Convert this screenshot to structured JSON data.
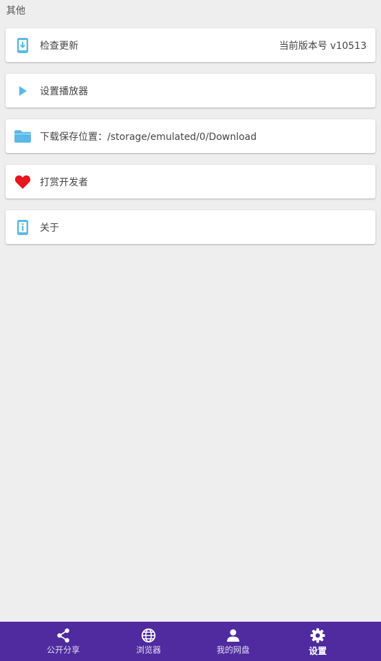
{
  "section": {
    "title": "其他"
  },
  "items": [
    {
      "label": "检查更新",
      "value": "当前版本号 v10513",
      "icon": "phone-download-icon"
    },
    {
      "label": "设置播放器",
      "icon": "play-icon"
    },
    {
      "label": "下载保存位置：/storage/emulated/0/Download",
      "icon": "folder-icon"
    },
    {
      "label": "打赏开发者",
      "icon": "heart-icon"
    },
    {
      "label": "关于",
      "icon": "phone-info-icon"
    }
  ],
  "bottom_nav": {
    "items": [
      {
        "label": "公开分享",
        "icon": "share-icon"
      },
      {
        "label": "浏览器",
        "icon": "globe-icon"
      },
      {
        "label": "我的网盘",
        "icon": "person-icon"
      },
      {
        "label": "设置",
        "icon": "gear-icon",
        "active": true
      }
    ]
  },
  "colors": {
    "background": "#eeeeee",
    "card": "#ffffff",
    "icon_blue": "#5bb8e8",
    "heart_red": "#e8141e",
    "nav_bar": "#4f2b9f"
  }
}
